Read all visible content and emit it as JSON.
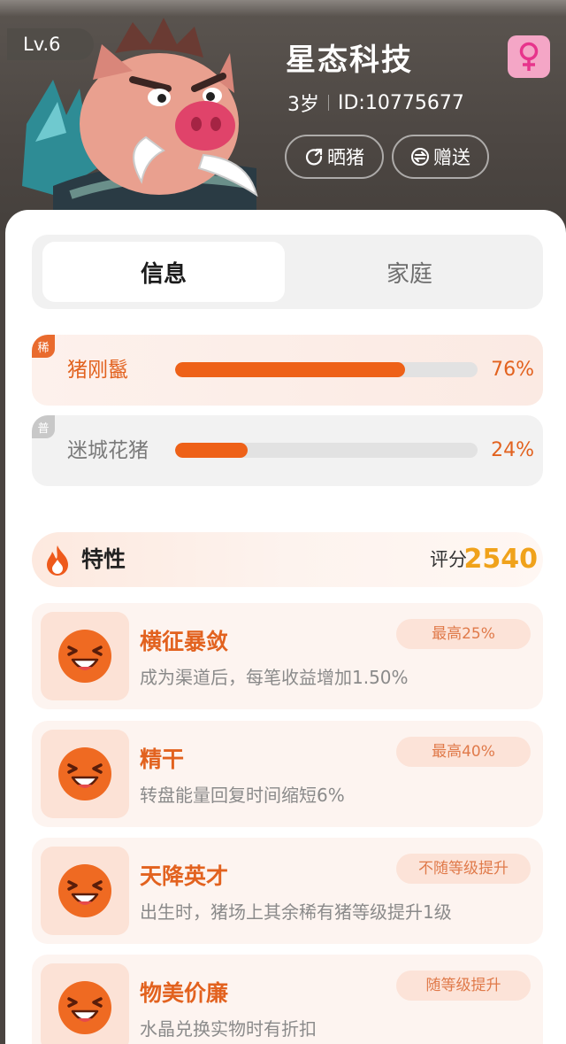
{
  "header": {
    "level": "Lv.6",
    "name": "星态科技",
    "age": "3岁",
    "id": "ID:10775677",
    "share_label": "晒猪",
    "gift_label": "赠送",
    "gender_icon": "female-icon",
    "gender_color": "#f4a6c6"
  },
  "tabs": [
    {
      "label": "信息",
      "active": true
    },
    {
      "label": "家庭",
      "active": false
    }
  ],
  "breeds": [
    {
      "tag": "稀",
      "name": "猪刚鬣",
      "percent_text": "76%",
      "percent": 76
    },
    {
      "tag": "普",
      "name": "迷城花猪",
      "percent_text": "24%",
      "percent": 24
    }
  ],
  "traits": {
    "title": "特性",
    "score_label": "评分",
    "score": "2540",
    "items": [
      {
        "title": "横征暴敛",
        "desc": "成为渠道后，每笔收益增加1.50%",
        "badge": "最高25%"
      },
      {
        "title": "精干",
        "desc": "转盘能量回复时间缩短6%",
        "badge": "最高40%"
      },
      {
        "title": "天降英才",
        "desc": "出生时，猪场上其余稀有猪等级提升1级",
        "badge": "不随等级提升"
      },
      {
        "title": "物美价廉",
        "desc": "水晶兑换实物时有折扣",
        "badge": "随等级提升"
      }
    ]
  },
  "colors": {
    "accent": "#ee6118",
    "score": "#f0a21b"
  }
}
